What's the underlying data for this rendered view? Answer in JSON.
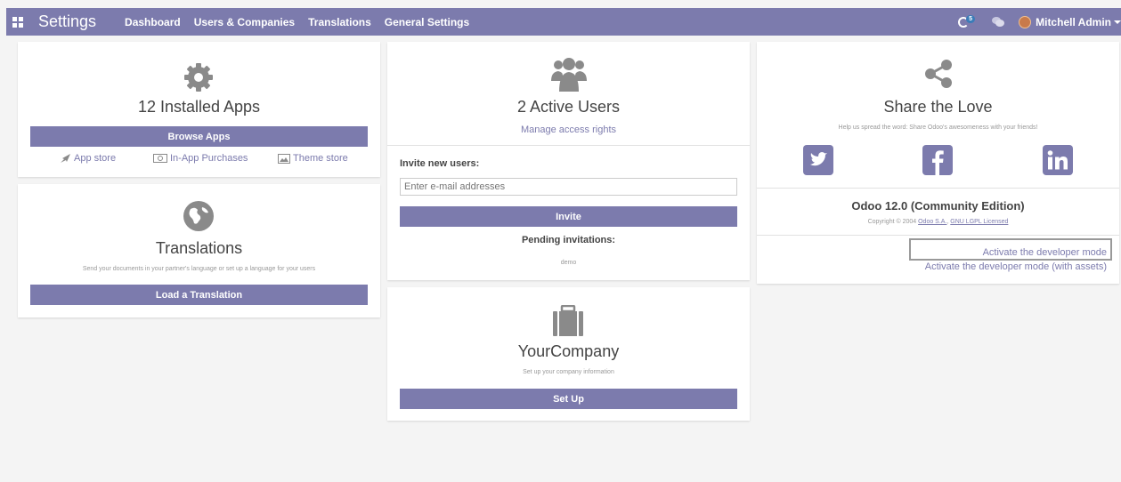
{
  "topbar": {
    "app_title": "Settings",
    "menu": [
      "Dashboard",
      "Users & Companies",
      "Translations",
      "General Settings"
    ],
    "activity_count": "5",
    "user_name": "Mitchell Admin"
  },
  "apps_card": {
    "title": "12 Installed Apps",
    "browse_label": "Browse Apps",
    "links": [
      "App store",
      "In-App Purchases",
      "Theme store"
    ]
  },
  "translations_card": {
    "title": "Translations",
    "subtitle": "Send your documents in your partner's language or set up a language for your users",
    "button": "Load a Translation"
  },
  "users_card": {
    "title": "2 Active Users",
    "manage_link": "Manage access rights",
    "invite_label": "Invite new users:",
    "email_placeholder": "Enter e-mail addresses",
    "invite_button": "Invite",
    "pending_label": "Pending invitations:",
    "pending_items": [
      "demo"
    ]
  },
  "company_card": {
    "title": "YourCompany",
    "subtitle": "Set up your company information",
    "button": "Set Up"
  },
  "share_card": {
    "title": "Share the Love",
    "subtitle": "Help us spread the word: Share Odoo's awesomeness with your friends!",
    "version_title": "Odoo 12.0 (Community Edition)",
    "copyright_prefix": "Copyright © 2004",
    "copyright_company": "Odoo S.A.",
    "copyright_license": "GNU LGPL Licensed",
    "dev_mode": "Activate the developer mode",
    "dev_mode_assets": "Activate the developer mode (with assets)"
  },
  "colors": {
    "primary": "#7c7bad",
    "background": "#f4f4f4"
  }
}
